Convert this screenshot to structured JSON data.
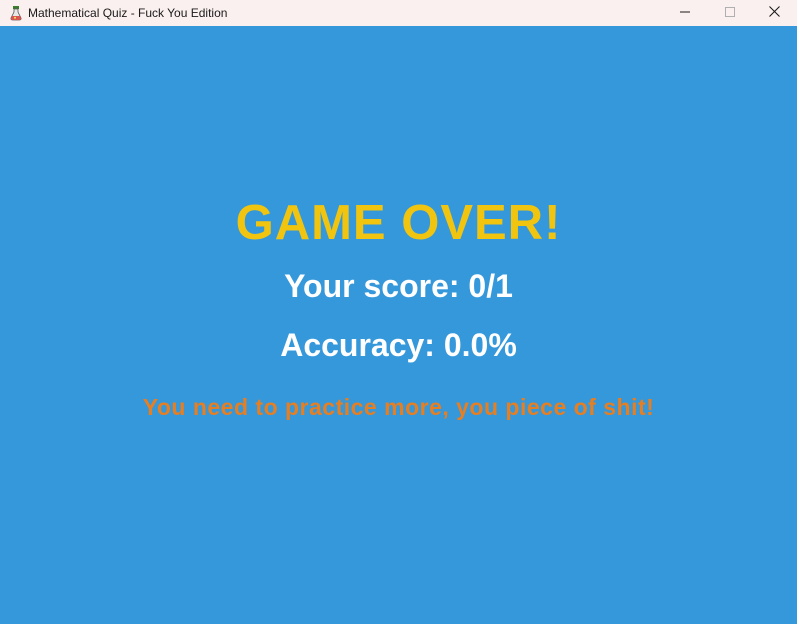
{
  "window": {
    "title": "Mathematical Quiz - Fuck You Edition",
    "icon": "flask-icon"
  },
  "controls": {
    "minimize_icon": "minimize-icon",
    "maximize_icon": "maximize-icon",
    "close_icon": "close-icon"
  },
  "game": {
    "heading": "GAME OVER!",
    "score_text": "Your score: 0/1",
    "accuracy_text": "Accuracy: 0.0%",
    "message": "You need to practice more, you piece of shit!"
  },
  "colors": {
    "background": "#3598db",
    "heading": "#f1c40f",
    "text": "#ffffff",
    "message": "#e67e22",
    "titlebar": "#faf0ef"
  }
}
